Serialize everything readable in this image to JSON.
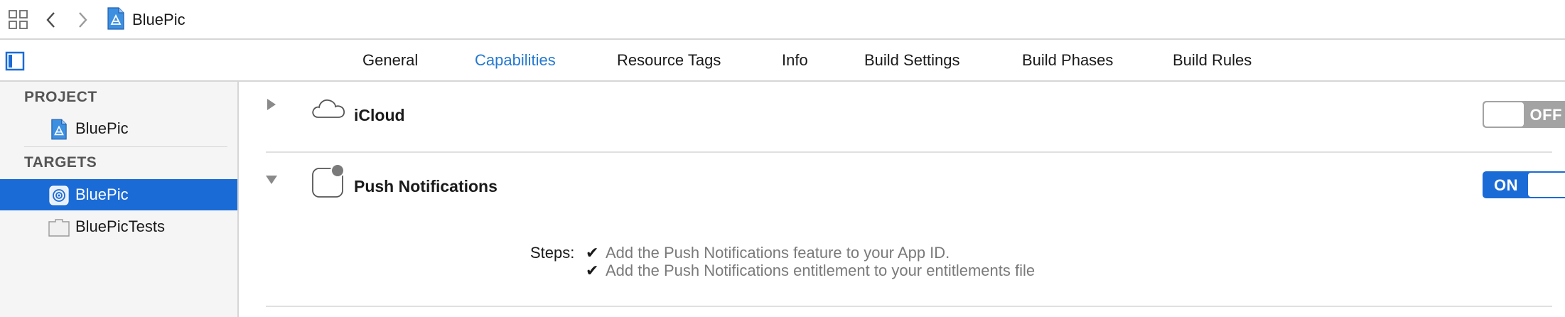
{
  "jumpbar": {
    "grid_icon": "related-items-grid-icon",
    "back_icon": "chevron-left-icon",
    "forward_icon": "chevron-right-icon",
    "project_icon": "xcode-project-icon",
    "project_name": "BluePic"
  },
  "tabs": [
    {
      "label": "General"
    },
    {
      "label": "Capabilities"
    },
    {
      "label": "Resource Tags"
    },
    {
      "label": "Info"
    },
    {
      "label": "Build Settings"
    },
    {
      "label": "Build Phases"
    },
    {
      "label": "Build Rules"
    }
  ],
  "active_tab": "Capabilities",
  "sidebar": {
    "project_header": "PROJECT",
    "project_item": "BluePic",
    "targets_header": "TARGETS",
    "targets": [
      {
        "label": "BluePic",
        "icon": "app-target-icon",
        "selected": true
      },
      {
        "label": "BluePicTests",
        "icon": "test-bundle-icon",
        "selected": false
      }
    ]
  },
  "capabilities": [
    {
      "name": "iCloud",
      "icon": "cloud-icon",
      "expanded": false,
      "toggle": "OFF"
    },
    {
      "name": "Push Notifications",
      "icon": "notification-badge-icon",
      "expanded": true,
      "toggle": "ON",
      "steps_label": "Steps:",
      "steps": [
        "Add the Push Notifications feature to your App ID.",
        "Add the Push Notifications entitlement to your entitlements file"
      ]
    }
  ],
  "colors": {
    "accent": "#2479d0",
    "selection": "#1b6bd6",
    "toggle_off": "#a3a3a3"
  }
}
